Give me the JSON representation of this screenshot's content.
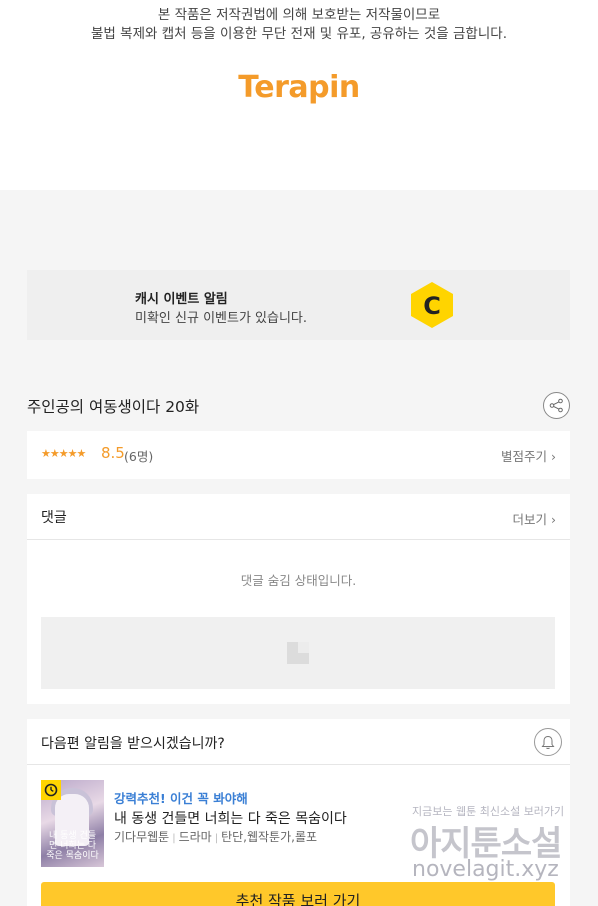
{
  "copyright": {
    "line1": "본 작품은 저작권법에 의해 보호받는 저작물이므로",
    "line2": "불법 복제와 캡처 등을 이용한 무단 전재 및 유포, 공유하는 것을 금합니다.",
    "logo_text": "Terapin",
    "logo_color": "#f49b2a"
  },
  "cash_banner": {
    "title": "캐시 이벤트 알림",
    "subtitle": "미확인 신규 이벤트가 있습니다.",
    "icon": "cash-c-icon",
    "icon_letter": "C"
  },
  "episode": {
    "title": "주인공의 여동생이다 20화",
    "share_icon": "share-icon"
  },
  "rating": {
    "stars_text": "★★★★★",
    "score": "8.5",
    "count": "(6명)",
    "rate_link": "별점주기",
    "rating_value": 4.25
  },
  "comments": {
    "title": "댓글",
    "more_link": "더보기",
    "hidden_message": "댓글 숨김 상태입니다."
  },
  "next_episode": {
    "prompt": "다음편 알림을 받으시겠습니까?",
    "bell_icon": "bell-icon"
  },
  "recommendation": {
    "label": "강력추천! 이건 꼭 봐야해",
    "title": "내 동생 건들면 너희는 다 죽은 목숨이다",
    "genres": [
      "기다무웹툰",
      "드라마",
      "탄단,웹작툰가,롤포"
    ],
    "thumb_text": "내 동생 건들면 너희는 다 죽은 목숨이다",
    "badge_icon": "clock-icon",
    "cta": "추천 작품 보러 가기"
  },
  "watermark": {
    "small": "지금보는 웹툰 최신소설 보러가기",
    "big": "아지툰소설",
    "url": "novelagit.xyz"
  },
  "colors": {
    "accent": "#f49b2a",
    "cta": "#ffc82a",
    "link_blue": "#3a7fd5",
    "badge_yellow": "#ffd400"
  }
}
